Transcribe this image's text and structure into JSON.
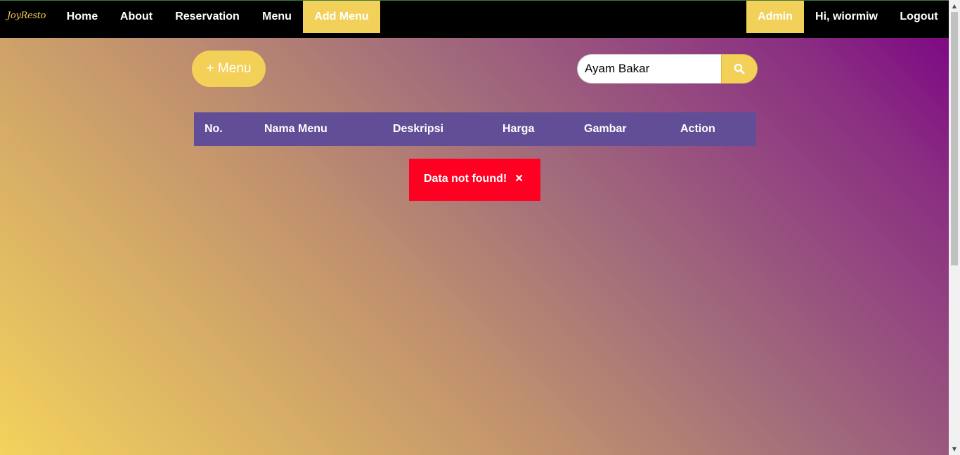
{
  "brand": "JoyResto",
  "nav": {
    "home": "Home",
    "about": "About",
    "reservation": "Reservation",
    "menu": "Menu",
    "add_menu": "Add Menu",
    "admin": "Admin",
    "greeting": "Hi, wiormiw",
    "logout": "Logout"
  },
  "toolbar": {
    "add_label": "+ Menu"
  },
  "search": {
    "value": "Ayam Bakar",
    "icon": "search-icon"
  },
  "table": {
    "columns": [
      "No.",
      "Nama Menu",
      "Deskripsi",
      "Harga",
      "Gambar",
      "Action"
    ]
  },
  "alert": {
    "message": "Data not found!",
    "close_symbol": "×"
  },
  "scrollbar": {
    "up": "▲",
    "down": "▼"
  },
  "colors": {
    "accent": "#f3d058",
    "table_header": "#614e96",
    "alert": "#ff0022",
    "navbar": "#000000"
  }
}
